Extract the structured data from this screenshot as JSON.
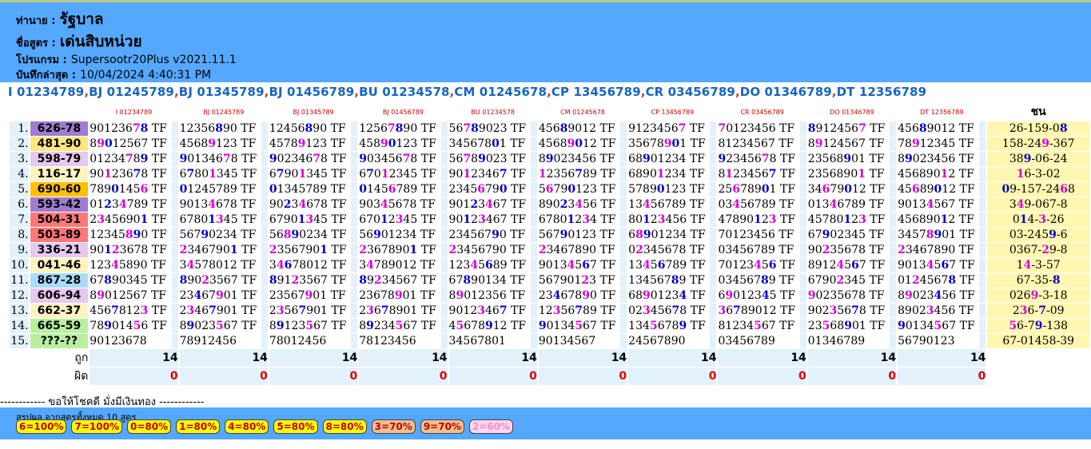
{
  "header": {
    "dealer_label": "ท่านาย :",
    "dealer_value": "รัฐบาล",
    "formula_label": "ชื่อสูตร :",
    "formula_value": "เด่นสิบหน่วย",
    "program_label": "โปรแกรม :",
    "program_value": "Supersootr20Plus v2021.11.1",
    "saved_label": "บันทึกล่าสุด :",
    "saved_value": "10/04/2024 4:40:31 PM"
  },
  "formula_line": [
    "I 01234789",
    "BJ 01245789",
    "BJ 01345789",
    "BJ 01456789",
    "BU 01234578",
    "CM 01245678",
    "CP 13456789",
    "CR 03456789",
    "DO 01346789",
    "DT 12356789"
  ],
  "formula_separator": ",",
  "columns": [
    "I 01234789",
    "BJ 01245789",
    "BJ 01345789",
    "BJ 01456789",
    "BU 01234578",
    "CM 01245678",
    "CP 13456789",
    "CR 03456789",
    "DO 01346789",
    "DT 12356789"
  ],
  "chon_header": "ชน",
  "rows": [
    {
      "no": "1.",
      "key": "626-78",
      "key_bg": "#a07cd0",
      "chon": "26-159-08",
      "cells": [
        "901236 78 TF",
        "12356890 TF",
        "12456890 TF",
        "12567890 TF",
        "56789023 TF",
        "45689012 TF",
        "91234567 TF",
        "70123456 TF",
        "89124567 TF",
        "45689012 TF"
      ]
    },
    {
      "no": "2.",
      "key": "481-90",
      "key_bg": "#ffe680",
      "chon": "158-249-367",
      "cells": [
        "89012567 TF",
        "45689123 TF",
        "45789123 TF",
        "45890123 TF",
        "34567801 TF",
        "45689012 TF",
        "35678901 TF",
        "81234567 TF",
        "89124567 TF",
        "78912345 TF"
      ]
    },
    {
      "no": "3.",
      "key": "598-79",
      "key_bg": "#e6c8f0",
      "chon": "389-06-24",
      "cells": [
        "01234789 TF",
        "90134678 TF",
        "90234678 TF",
        "90345678 TF",
        "56789023 TF",
        "89023456 TF",
        "68901234 TF",
        "92345678 TF",
        "23568901 TF",
        "89023456 TF"
      ]
    },
    {
      "no": "4.",
      "key": "116-17",
      "key_bg": "#fff3c0",
      "chon": "16-3-02",
      "cells": [
        "90123678 TF",
        "67801345 TF",
        "67901345 TF",
        "67012345 TF",
        "90123467 TF",
        "12356789 TF",
        "68901234 TF",
        "81234567 TF",
        "23568901 TF",
        "45689012 TF"
      ]
    },
    {
      "no": "5.",
      "key": "690-60",
      "key_bg": "#ffc000",
      "chon": "09-157-2468",
      "cells": [
        "78901456 TF",
        "01245789 TF",
        "01345789 TF",
        "01456789 TF",
        "23456790 TF",
        "56790123 TF",
        "57890123 TF",
        "25678901 TF",
        "34679012 TF",
        "45689012 TF"
      ]
    },
    {
      "no": "6.",
      "key": "593-42",
      "key_bg": "#a07cd0",
      "chon": "349-067-8",
      "cells": [
        "01234789 TF",
        "90134678 TF",
        "90234678 TF",
        "90345678 TF",
        "90123467 TF",
        "89023456 TF",
        "13456789 TF",
        "03456789 TF",
        "01346789 TF",
        "90134567 TF"
      ]
    },
    {
      "no": "7.",
      "key": "504-31",
      "key_bg": "#ff7878",
      "chon": "014-3-26",
      "cells": [
        "23456901 TF",
        "67801345 TF",
        "67901345 TF",
        "67012345 TF",
        "90123467 TF",
        "67801234 TF",
        "80123456 TF",
        "47890123 TF",
        "45780123 TF",
        "45689012 TF"
      ]
    },
    {
      "no": "8.",
      "key": "503-89",
      "key_bg": "#ff7878",
      "chon": "03-2459-6",
      "cells": [
        "12345890 TF",
        "56790234 TF",
        "56890234 TF",
        "56901234 TF",
        "23456790 TF",
        "56790123 TF",
        "68901234 TF",
        "70123456 TF",
        "67902345 TF",
        "34578901 TF"
      ]
    },
    {
      "no": "9.",
      "key": "336-21",
      "key_bg": "#e6c8f0",
      "chon": "0367-29-8",
      "cells": [
        "90123678 TF",
        "23467901 TF",
        "23567901 TF",
        "23678901 TF",
        "23456790 TF",
        "23467890 TF",
        "02345678 TF",
        "03456789 TF",
        "90235678 TF",
        "23467890 TF"
      ]
    },
    {
      "no": "10.",
      "key": "041-46",
      "key_bg": "#fff3c0",
      "chon": "14-3-57",
      "cells": [
        "12345890 TF",
        "34578012 TF",
        "34678012 TF",
        "34789012 TF",
        "12345689 TF",
        "90134567 TF",
        "13456789 TF",
        "70123456 TF",
        "89124567 TF",
        "90134567 TF"
      ]
    },
    {
      "no": "11.",
      "key": "867-28",
      "key_bg": "#a8dcff",
      "chon": "67-35-8",
      "cells": [
        "67890345 TF",
        "89023567 TF",
        "89123567 TF",
        "89234567 TF",
        "67890134 TF",
        "56790123 TF",
        "13456789 TF",
        "03456789 TF",
        "67902345 TF",
        "01245678 TF"
      ]
    },
    {
      "no": "12.",
      "key": "606-94",
      "key_bg": "#e6c8f0",
      "chon": "0269-3-18",
      "cells": [
        "89012567 TF",
        "23467901 TF",
        "23567901 TF",
        "23678901 TF",
        "89012356 TF",
        "23467890 TF",
        "68901234 TF",
        "69012345 TF",
        "90235678 TF",
        "89023456 TF"
      ]
    },
    {
      "no": "13.",
      "key": "662-37",
      "key_bg": "#fff3c0",
      "chon": "236-7-09",
      "cells": [
        "45678123 TF",
        "23467901 TF",
        "23567901 TF",
        "23678901 TF",
        "90123467 TF",
        "12356789 TF",
        "02345678 TF",
        "36789012 TF",
        "90235678 TF",
        "89023456 TF"
      ]
    },
    {
      "no": "14.",
      "key": "665-59",
      "key_bg": "#b8f0a0",
      "chon": "56-79-138",
      "cells": [
        "78901456 TF",
        "89023567 TF",
        "89123567 TF",
        "89234567 TF",
        "45678912 TF",
        "90134567 TF",
        "13456789 TF",
        "81234567 TF",
        "23568901 TF",
        "90134567 TF"
      ]
    },
    {
      "no": "15.",
      "key": "???-??",
      "key_bg": "#b8f0a0",
      "chon": "67-01458-39",
      "cells": [
        "90123678",
        "78912456",
        "78012456",
        "78123456",
        "34567801",
        "90134567",
        "24567890",
        "03456789",
        "01346789",
        "56790123"
      ]
    }
  ],
  "totals": {
    "correct_label": "ถูก",
    "wrong_label": "ผิด",
    "correct": [
      "14",
      "14",
      "14",
      "14",
      "14",
      "14",
      "14",
      "14",
      "14",
      "14"
    ],
    "wrong": [
      "0",
      "0",
      "0",
      "0",
      "0",
      "0",
      "0",
      "0",
      "0",
      "0"
    ]
  },
  "luck_text": "------------ ขอให้โชคดี มั่งมีเงินทอง ------------",
  "summary": {
    "title": "สรุปผล จากสูตรทั้งหมด 10 สูตร",
    "badges": [
      {
        "label": "6=100%",
        "level": 100
      },
      {
        "label": "7=100%",
        "level": 100
      },
      {
        "label": "0=80%",
        "level": 80
      },
      {
        "label": "1=80%",
        "level": 80
      },
      {
        "label": "4=80%",
        "level": 80
      },
      {
        "label": "5=80%",
        "level": 80
      },
      {
        "label": "8=80%",
        "level": 80
      },
      {
        "label": "3=70%",
        "level": 70
      },
      {
        "label": "9=70%",
        "level": 70
      },
      {
        "label": "2=60%",
        "level": 60
      }
    ]
  },
  "colors": {
    "header_bg": "#55a8ff",
    "formula_text": "#1565c0",
    "column_header_text": "#d00000",
    "chon_bg": "#fff7b0",
    "match_digit_blue": "#0000c8",
    "match_digit_magenta": "#d400d4"
  }
}
